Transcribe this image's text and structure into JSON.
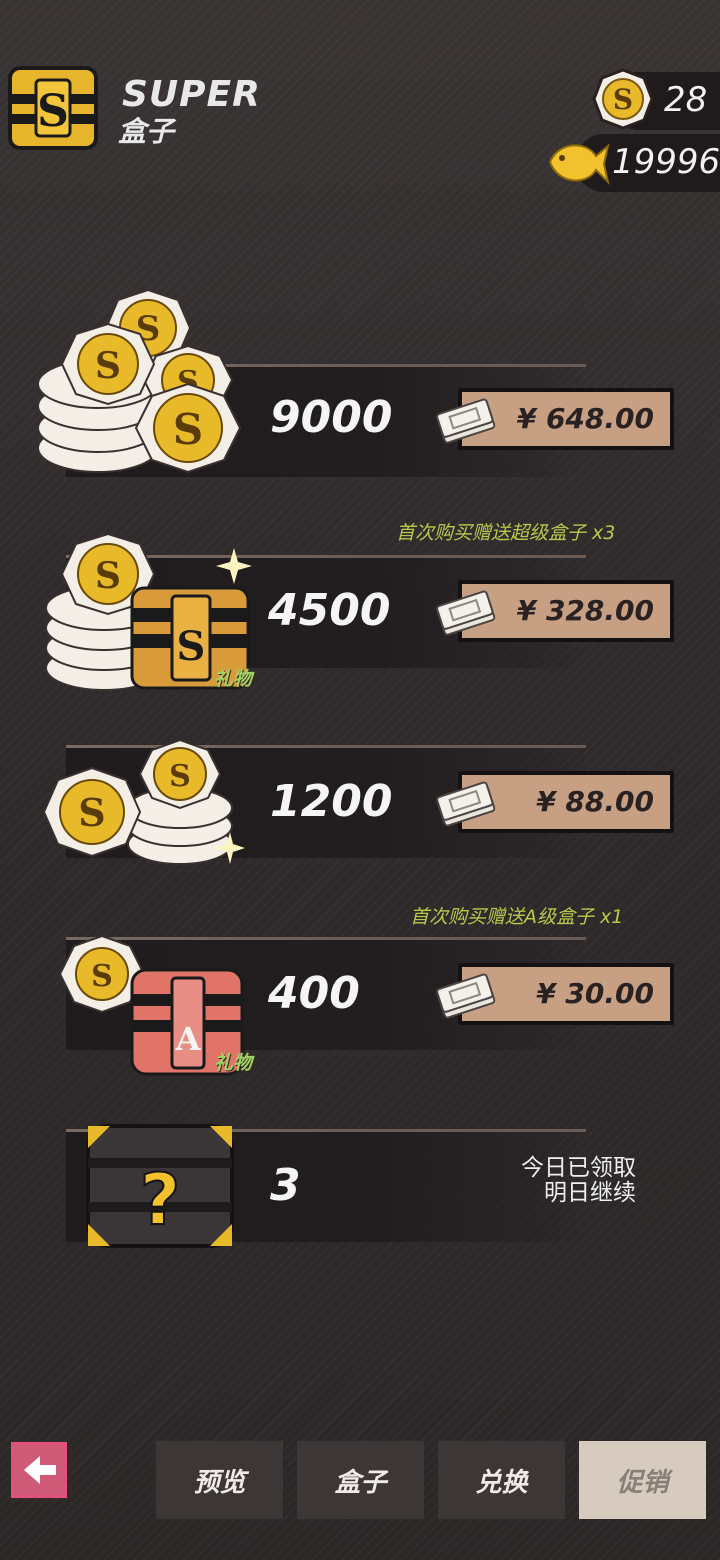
{
  "header": {
    "logo_title": "SUPER",
    "logo_subtitle": "盒子",
    "currency_coin": "28",
    "currency_fish": "19996"
  },
  "offers": [
    {
      "amount": "9000",
      "price": "¥ 648.00",
      "promo": "",
      "gift_tag": ""
    },
    {
      "amount": "4500",
      "price": "¥ 328.00",
      "promo": "首次购买赠送超级盒子 x3",
      "gift_tag": "礼物"
    },
    {
      "amount": "1200",
      "price": "¥ 88.00",
      "promo": "",
      "gift_tag": ""
    },
    {
      "amount": "400",
      "price": "¥ 30.00",
      "promo": "首次购买赠送A级盒子 x1",
      "gift_tag": "礼物"
    }
  ],
  "mystery": {
    "amount": "3",
    "status_line1": "今日已领取",
    "status_line2": "明日继续"
  },
  "nav": {
    "tabs": [
      "预览",
      "盒子",
      "兑换",
      "促销"
    ]
  },
  "colors": {
    "accent_gold": "#e8b928",
    "price_btn": "#c79f83",
    "back_btn": "#cf5a77",
    "promo_text": "#b6c94a"
  }
}
